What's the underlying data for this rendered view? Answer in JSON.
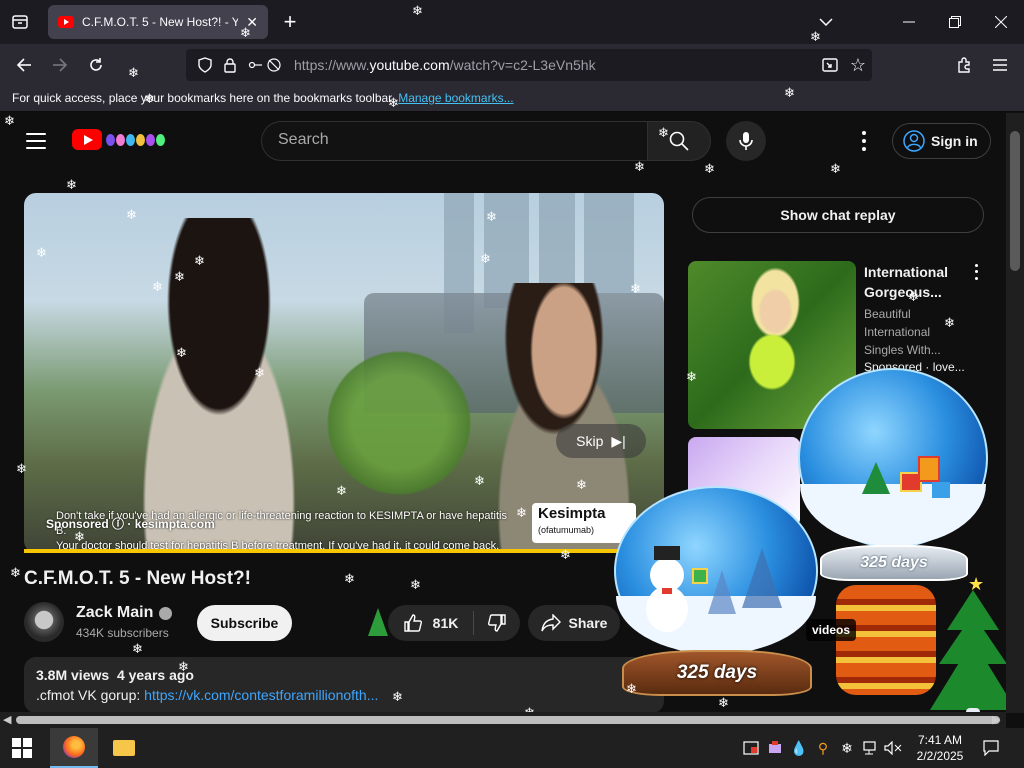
{
  "browser": {
    "tab_title": "C.F.M.O.T. 5 - New Host?! - YouTube",
    "new_tab": "+",
    "url_prefix": "https://www.",
    "url_domain": "youtube.com",
    "url_path": "/watch?v=c2-L3eVn5hk",
    "bookmarks_text": "For quick access, place your bookmarks here on the bookmarks toolbar.",
    "bookmarks_link": "Manage bookmarks..."
  },
  "youtube": {
    "search_placeholder": "Search",
    "sign_in": "Sign in",
    "chat_replay": "Show chat replay"
  },
  "ad": {
    "skip": "Skip",
    "disclaimer_line1": "Don't take if you've had an allergic or life-threatening reaction to KESIMPTA or have hepatitis B.",
    "disclaimer_line2": "Your doctor should test for hepatitis B before treatment. If you've had it, it could come back.",
    "sponsored": "Sponsored",
    "advertiser": "kesimpta.com",
    "brand": "Kesimpta",
    "brand_sub": "(ofatumumab)"
  },
  "video": {
    "title": "C.F.M.O.T. 5 - New Host?!",
    "channel": "Zack Main",
    "subscribers": "434K subscribers",
    "subscribe": "Subscribe",
    "likes": "81K",
    "share": "Share",
    "views": "3.8M views",
    "age": "4 years ago",
    "desc_prefix": ".cfmot VK gorup: ",
    "desc_link": "https://vk.com/contestforamillionofth..."
  },
  "sidebar": {
    "ad_title": "International Gorgeous...",
    "ad_desc": "Beautiful International Singles With...",
    "ad_sponsored": "Sponsored · love...",
    "videos_badge": "videos"
  },
  "decor": {
    "globe_counter_left": "325 days",
    "globe_counter_right": "325 days"
  },
  "taskbar": {
    "time": "7:41 AM",
    "date": "2/2/2025"
  },
  "colors": {
    "youtube_red": "#ff0000",
    "link_blue": "#3ea6ff",
    "progress_yellow": "#f6c600"
  }
}
